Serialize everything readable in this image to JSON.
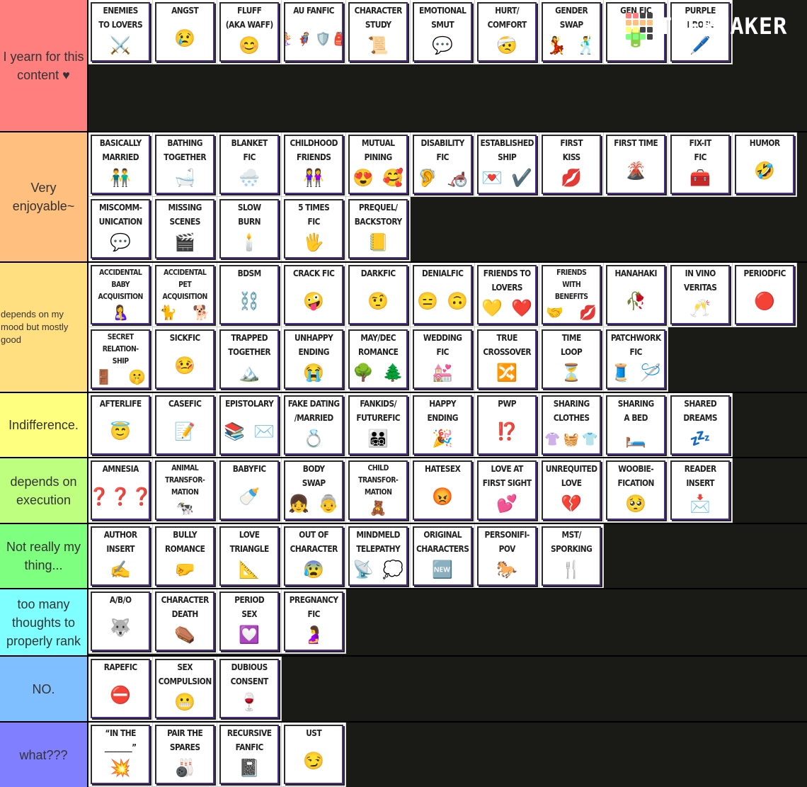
{
  "logo": {
    "text": "TiERMAKER",
    "grid_colors": [
      "#ff7f7f",
      "#ff7f7f",
      "#444444",
      "#444444",
      "#ffbf7f",
      "#ffbf7f",
      "#ffbf7f",
      "#ffbf7f",
      "#ffff7f",
      "#ffff7f",
      "#444444",
      "#444444",
      "#7fff7f",
      "#7fff7f",
      "#7fff7f",
      "#444444"
    ]
  },
  "tiers": [
    {
      "label": "I yearn for this content ♥",
      "color": "#ff7f7f",
      "items": [
        {
          "title": "ENEMIES\nTO LOVERS",
          "icons": [
            "⚔️"
          ]
        },
        {
          "title": "ANGST",
          "icons": [
            "😢"
          ]
        },
        {
          "title": "FLUFF\n(AKA WAFF)",
          "icons": [
            "😊"
          ]
        },
        {
          "title": "AU FANFIC",
          "icons": [
            "🧜‍♀️",
            "🦸",
            "🛡️",
            "🎒"
          ]
        },
        {
          "title": "CHARACTER\nSTUDY",
          "icons": [
            "📜"
          ]
        },
        {
          "title": "EMOTIONAL\nSMUT",
          "icons": [
            "💬"
          ]
        },
        {
          "title": "HURT/\nCOMFORT",
          "icons": [
            "🤕"
          ]
        },
        {
          "title": "GENDER\nSWAP",
          "icons": [
            "💃",
            "🕺"
          ]
        },
        {
          "title": "GEN FIC",
          "icons": [
            "🔋"
          ]
        },
        {
          "title": "PURPLE\nPROSE",
          "icons": [
            "🖊️"
          ]
        }
      ]
    },
    {
      "label": "Very enjoyable~",
      "color": "#ffbf7f",
      "items": [
        {
          "title": "BASICALLY\nMARRIED",
          "icons": [
            "👬"
          ]
        },
        {
          "title": "BATHING\nTOGETHER",
          "icons": [
            "🛁"
          ]
        },
        {
          "title": "BLANKET\nFIC",
          "icons": [
            "🌨️"
          ]
        },
        {
          "title": "CHILDHOOD\nFRIENDS",
          "icons": [
            "👭"
          ]
        },
        {
          "title": "MUTUAL\nPINING",
          "icons": [
            "😍",
            "🥰"
          ]
        },
        {
          "title": "DISABILITY\nFIC",
          "icons": [
            "🦻",
            "🦽"
          ]
        },
        {
          "title": "ESTABLISHED\nSHIP",
          "icons": [
            "💌",
            "✔️"
          ]
        },
        {
          "title": "FIRST\nKISS",
          "icons": [
            "💋"
          ]
        },
        {
          "title": "FIRST TIME",
          "icons": [
            "🌋"
          ]
        },
        {
          "title": "FIX-IT\nFIC",
          "icons": [
            "🧰"
          ]
        },
        {
          "title": "HUMOR",
          "icons": [
            "🤣"
          ]
        },
        {
          "title": "MISCOMM-\nUNICATION",
          "icons": [
            "💬"
          ]
        },
        {
          "title": "MISSING\nSCENES",
          "icons": [
            "🎬"
          ]
        },
        {
          "title": "SLOW\nBURN",
          "icons": [
            "🕯️"
          ]
        },
        {
          "title": "5 TIMES\nFIC",
          "icons": [
            "🖐️"
          ]
        },
        {
          "title": "PREQUEL/\nBACKSTORY",
          "icons": [
            "📒"
          ]
        }
      ]
    },
    {
      "label": "depends on my mood but mostly good",
      "color": "#ffdf7f",
      "small": true,
      "items": [
        {
          "title": "ACCIDENTAL\nBABY\nACQUISITION",
          "icons": [
            "🤱"
          ]
        },
        {
          "title": "ACCIDENTAL\nPET\nACQUISITION",
          "icons": [
            "🐈",
            "🐕"
          ]
        },
        {
          "title": "BDSM",
          "icons": [
            "⛓️"
          ]
        },
        {
          "title": "CRACK FIC",
          "icons": [
            "🤪"
          ]
        },
        {
          "title": "DARKFIC",
          "icons": [
            "🤨"
          ]
        },
        {
          "title": "DENIALFIC",
          "icons": [
            "😑",
            "🙃"
          ]
        },
        {
          "title": "FRIENDS TO\nLOVERS",
          "icons": [
            "💛",
            "❤️"
          ]
        },
        {
          "title": "FRIENDS\nWITH\nBENEFITS",
          "icons": [
            "🤝",
            "💋"
          ]
        },
        {
          "title": "HANAHAKI",
          "icons": [
            "🥀"
          ]
        },
        {
          "title": "IN VINO\nVERITAS",
          "icons": [
            "🥂"
          ]
        },
        {
          "title": "PERIODFIC",
          "icons": [
            "🔴"
          ]
        },
        {
          "title": "SECRET\nRELATION-\nSHIP",
          "icons": [
            "🚪",
            "🤫"
          ]
        },
        {
          "title": "SICKFIC",
          "icons": [
            "🤒"
          ]
        },
        {
          "title": "TRAPPED\nTOGETHER",
          "icons": [
            "🏔️"
          ]
        },
        {
          "title": "UNHAPPY\nENDING",
          "icons": [
            "😭"
          ]
        },
        {
          "title": "MAY/DEC\nROMANCE",
          "icons": [
            "🌳",
            "🌲"
          ]
        },
        {
          "title": "WEDDING\nFIC",
          "icons": [
            "💒"
          ]
        },
        {
          "title": "TRUE\nCROSSOVER",
          "icons": [
            "🔀"
          ]
        },
        {
          "title": "TIME\nLOOP",
          "icons": [
            "⏳"
          ]
        },
        {
          "title": "PATCHWORK\nFIC",
          "icons": [
            "🧵",
            "🪡"
          ]
        }
      ]
    },
    {
      "label": "Indifference.",
      "color": "#ffff7f",
      "items": [
        {
          "title": "AFTERLIFE",
          "icons": [
            "😇"
          ]
        },
        {
          "title": "CASEFIC",
          "icons": [
            "📝"
          ]
        },
        {
          "title": "EPISTOLARY",
          "icons": [
            "📚",
            "✉️"
          ]
        },
        {
          "title": "FAKE DATING\n/MARRIED",
          "icons": [
            "💍"
          ]
        },
        {
          "title": "FANKIDS/\nFUTUREFIC",
          "icons": [
            "👨‍👨‍👧‍👦"
          ]
        },
        {
          "title": "HAPPY\nENDING",
          "icons": [
            "🎉"
          ]
        },
        {
          "title": "PWP",
          "icons": [
            "⁉️"
          ]
        },
        {
          "title": "SHARING\nCLOTHES",
          "icons": [
            "👚",
            "🧺",
            "👕"
          ]
        },
        {
          "title": "SHARING\nA BED",
          "icons": [
            "🛏️"
          ]
        },
        {
          "title": "SHARED\nDREAMS",
          "icons": [
            "💤"
          ]
        }
      ]
    },
    {
      "label": "depends on execution",
      "color": "#bfff7f",
      "items": [
        {
          "title": "AMNESIA",
          "icons": [
            "❓❓❓"
          ]
        },
        {
          "title": "ANIMAL\nTRANSFOR-\nMATION",
          "icons": [
            "🐄"
          ]
        },
        {
          "title": "BABYFIC",
          "icons": [
            "🍼"
          ]
        },
        {
          "title": "BODY\nSWAP",
          "icons": [
            "👧",
            "👵"
          ]
        },
        {
          "title": "CHILD\nTRANSFOR-\nMATION",
          "icons": [
            "🧸"
          ]
        },
        {
          "title": "HATESEX",
          "icons": [
            "😡"
          ]
        },
        {
          "title": "LOVE AT\nFIRST SIGHT",
          "icons": [
            "💕"
          ]
        },
        {
          "title": "UNREQUITED\nLOVE",
          "icons": [
            "💔"
          ]
        },
        {
          "title": "WOOBIE-\nFICATION",
          "icons": [
            "🥺"
          ]
        },
        {
          "title": "READER\nINSERT",
          "icons": [
            "📩"
          ]
        }
      ]
    },
    {
      "label": "Not really my thing...",
      "color": "#7fff7f",
      "items": [
        {
          "title": "AUTHOR\nINSERT",
          "icons": [
            "✍️"
          ]
        },
        {
          "title": "BULLY\nROMANCE",
          "icons": [
            "🤛"
          ]
        },
        {
          "title": "LOVE\nTRIANGLE",
          "icons": [
            "📐"
          ]
        },
        {
          "title": "OUT OF\nCHARACTER",
          "icons": [
            "😰"
          ]
        },
        {
          "title": "MINDMELD\nTELEPATHY",
          "icons": [
            "📡",
            "💭"
          ]
        },
        {
          "title": "ORIGINAL\nCHARACTERS",
          "icons": [
            "🆕"
          ]
        },
        {
          "title": "PERSONIFI-\nPOV",
          "icons": [
            "🐎"
          ]
        },
        {
          "title": "MST/\nSPORKING",
          "icons": [
            "🍴"
          ]
        }
      ]
    },
    {
      "label": "too many thoughts to properly rank",
      "color": "#7fffff",
      "items": [
        {
          "title": "A/B/O",
          "icons": [
            "🐺"
          ]
        },
        {
          "title": "CHARACTER\nDEATH",
          "icons": [
            "⚰️"
          ]
        },
        {
          "title": "PERIOD\nSEX",
          "icons": [
            "💟"
          ]
        },
        {
          "title": "PREGNANCY\nFIC",
          "icons": [
            "🤰"
          ]
        }
      ]
    },
    {
      "label": "NO.",
      "color": "#7fbfff",
      "items": [
        {
          "title": "RAPEFIC",
          "icons": [
            "⛔"
          ]
        },
        {
          "title": "SEX\nCOMPULSION",
          "icons": [
            "😬"
          ]
        },
        {
          "title": "DUBIOUS\nCONSENT",
          "icons": [
            "🍷"
          ]
        }
      ]
    },
    {
      "label": "what???",
      "color": "#7f7fff",
      "items": [
        {
          "title": "“IN THE\n________”",
          "icons": [
            "💥"
          ]
        },
        {
          "title": "PAIR THE\nSPARES",
          "icons": [
            "🎳"
          ]
        },
        {
          "title": "RECURSIVE\nFANFIC",
          "icons": [
            "📓"
          ]
        },
        {
          "title": "UST",
          "icons": [
            "😏"
          ]
        }
      ]
    }
  ]
}
